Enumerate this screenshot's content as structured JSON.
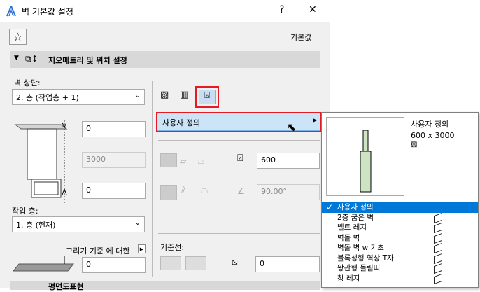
{
  "window": {
    "title": "벽 기본값 설정",
    "help": "?",
    "close": "✕",
    "default_label": "기본값"
  },
  "geometry": {
    "section_title": "지오메트리 및 위치 설정",
    "top_label": "벽 상단:",
    "top_value": "2. 층 (작업층 + 1)",
    "top_offset": "0",
    "height": "3000",
    "bottom_offset": "0",
    "home_story_label": "작업 층:",
    "home_story_value": "1. 층 (현재)",
    "draw_ref_label": "그리기 기준 에 대한",
    "ref_offset": "0",
    "thickness": "600",
    "angle": "90.00°",
    "refline_label": "기준선:",
    "refline_offset": "0",
    "profile_menu": "사용자 정의"
  },
  "popup": {
    "preview_name": "사용자 정의",
    "preview_size": "600 x 3000",
    "items": [
      {
        "label": "사용자 정의",
        "selected": true
      },
      {
        "label": "2층 굽은 벽"
      },
      {
        "label": "벨트 레지"
      },
      {
        "label": "벽돌 벽"
      },
      {
        "label": "벽돌 벽 w 기초"
      },
      {
        "label": "블록성형 역상 T자"
      },
      {
        "label": "왕관형 돌림띠"
      },
      {
        "label": "창 레지"
      }
    ]
  },
  "bottom_section": "평면도표현"
}
